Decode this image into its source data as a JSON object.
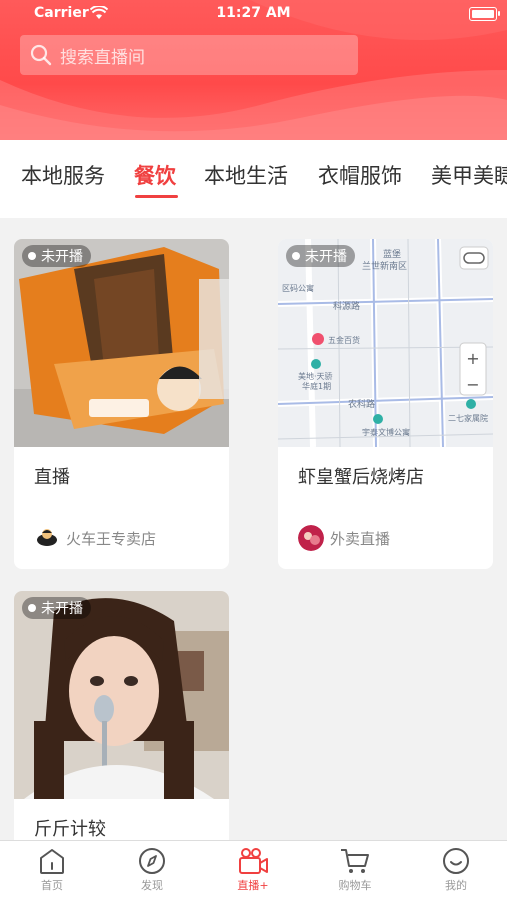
{
  "status_bar": {
    "carrier": "Carrier",
    "time": "11:27 AM"
  },
  "search": {
    "placeholder": "搜索直播间",
    "icon": "search-icon"
  },
  "tabs": [
    {
      "label": "本地服务",
      "active": false
    },
    {
      "label": "餐饮",
      "active": true
    },
    {
      "label": "本地生活",
      "active": false
    },
    {
      "label": "衣帽服饰",
      "active": false
    },
    {
      "label": "美甲美睫",
      "active": false
    }
  ],
  "cards": [
    {
      "badge": "未开播",
      "title": "直播",
      "shop": "火车王专卖店"
    },
    {
      "badge": "未开播",
      "title": "虾皇蟹后烧烤店",
      "shop": "外卖直播",
      "map_labels": [
        "蓝堡",
        "兰世新南区",
        "科源路",
        "五金百货",
        "美地·天骄",
        "华庭1期",
        "农科路",
        "宇泰文博公寓",
        "二七家属院",
        "区码公寓"
      ]
    },
    {
      "badge": "未开播",
      "title": "斤斤计较",
      "shop": ""
    }
  ],
  "nav": [
    {
      "label": "首页",
      "icon": "home-icon",
      "active": false
    },
    {
      "label": "发现",
      "icon": "compass-icon",
      "active": false
    },
    {
      "label": "直播+",
      "icon": "video-camera-icon",
      "active": true
    },
    {
      "label": "购物车",
      "icon": "cart-icon",
      "active": false
    },
    {
      "label": "我的",
      "icon": "smile-icon",
      "active": false
    }
  ],
  "colors": {
    "accent": "#f04040",
    "header": "#ff4f4f"
  }
}
